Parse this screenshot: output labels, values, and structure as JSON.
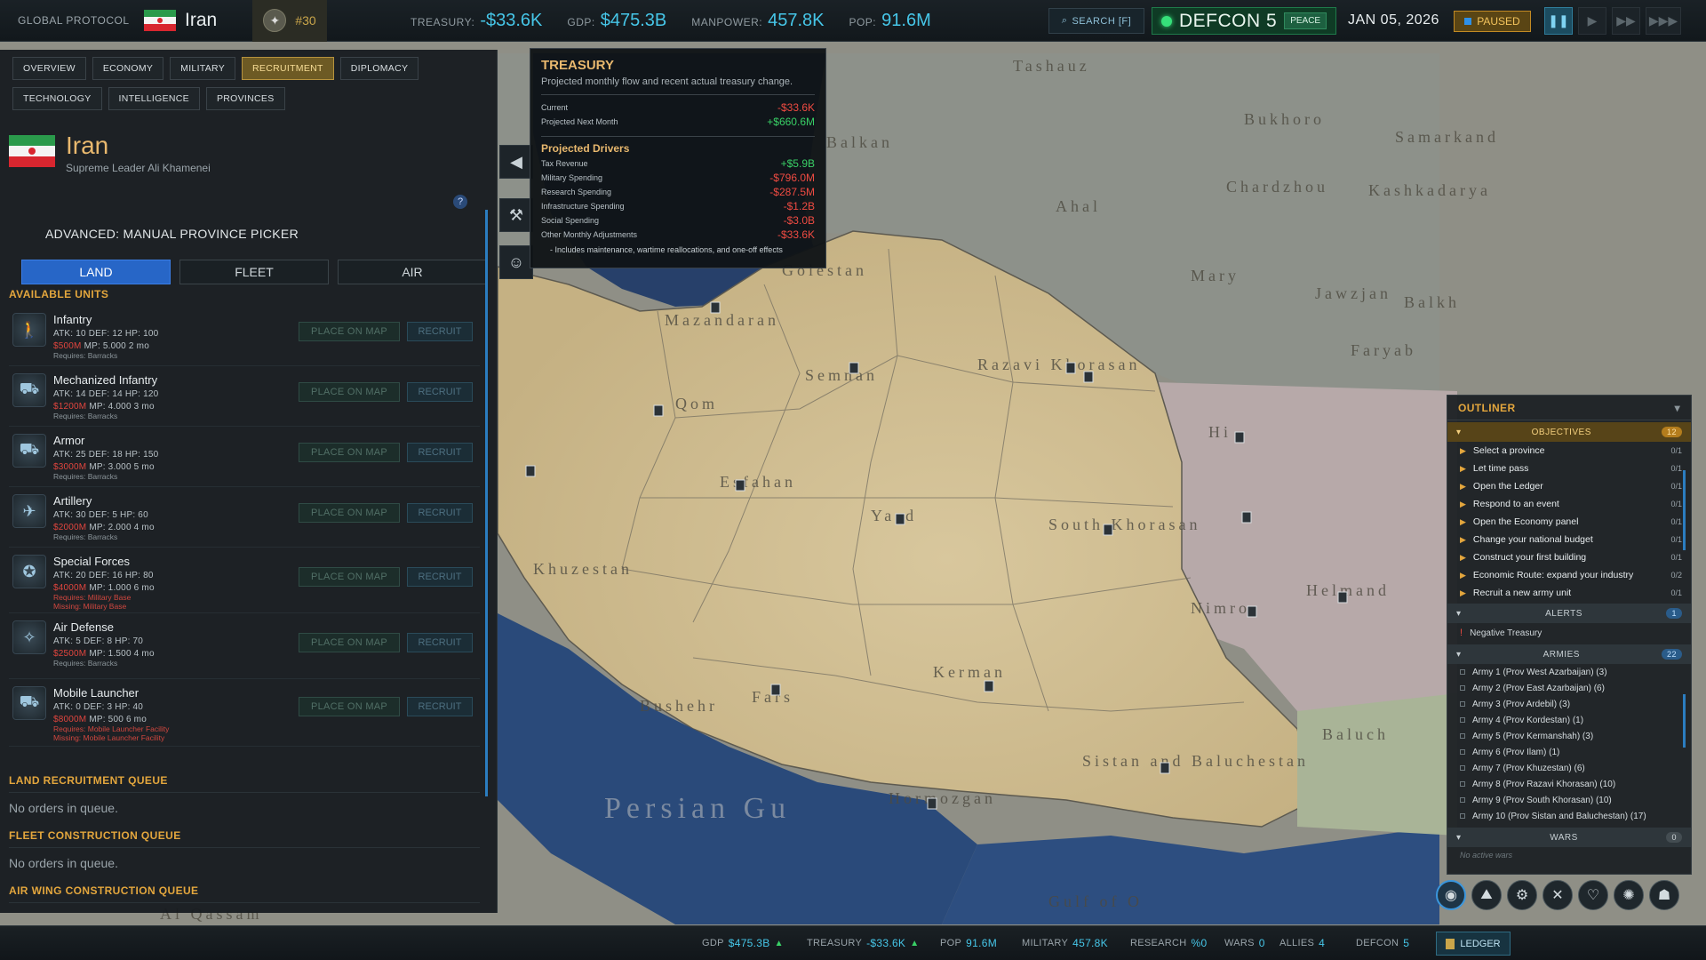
{
  "topbar": {
    "brand": "GLOBAL PROTOCOL",
    "country": "Iran",
    "rank": "#30",
    "treasury_label": "TREASURY:",
    "treasury_value": "-$33.6K",
    "gdp_label": "GDP:",
    "gdp_value": "$475.3B",
    "manpower_label": "MANPOWER:",
    "manpower_value": "457.8K",
    "pop_label": "POP:",
    "pop_value": "91.6M",
    "search_label": "SEARCH [F]",
    "defcon_label": "DEFCON 5",
    "peace_label": "PEACE",
    "date": "JAN 05, 2026",
    "paused_label": "PAUSED",
    "colors": {
      "accent": "#46c6e8",
      "defcon": "#36e07a",
      "paused": "#f3c35c"
    }
  },
  "panel": {
    "tabs": [
      "OVERVIEW",
      "ECONOMY",
      "MILITARY",
      "RECRUITMENT",
      "DIPLOMACY",
      "TECHNOLOGY",
      "INTELLIGENCE",
      "PROVINCES"
    ],
    "active_tab": "RECRUITMENT",
    "country": "Iran",
    "leader": "Supreme Leader Ali Khamenei",
    "help": "?",
    "advanced_label": "ADVANCED: MANUAL PROVINCE PICKER",
    "modes": [
      "LAND",
      "FLEET",
      "AIR"
    ],
    "active_mode": "LAND",
    "available_units_title": "AVAILABLE UNITS",
    "units": [
      {
        "name": "Infantry",
        "stats": "ATK: 10  DEF: 12  HP: 100",
        "cost": "$500M",
        "mp": "MP: 5.000  2 mo",
        "req": "Requires: Barracks",
        "missing": ""
      },
      {
        "name": "Mechanized Infantry",
        "stats": "ATK: 14  DEF: 14  HP: 120",
        "cost": "$1200M",
        "mp": "MP: 4.000  3 mo",
        "req": "Requires: Barracks",
        "missing": ""
      },
      {
        "name": "Armor",
        "stats": "ATK: 25  DEF: 18  HP: 150",
        "cost": "$3000M",
        "mp": "MP: 3.000  5 mo",
        "req": "Requires: Barracks",
        "missing": ""
      },
      {
        "name": "Artillery",
        "stats": "ATK: 30  DEF: 5  HP: 60",
        "cost": "$2000M",
        "mp": "MP: 2.000  4 mo",
        "req": "Requires: Barracks",
        "missing": ""
      },
      {
        "name": "Special Forces",
        "stats": "ATK: 20  DEF: 16  HP: 80",
        "cost": "$4000M",
        "mp": "MP: 1.000  6 mo",
        "req": "Requires: Military Base",
        "missing": "Missing: Military Base"
      },
      {
        "name": "Air Defense",
        "stats": "ATK: 5  DEF: 8  HP: 70",
        "cost": "$2500M",
        "mp": "MP: 1.500  4 mo",
        "req": "Requires: Barracks",
        "missing": ""
      },
      {
        "name": "Mobile Launcher",
        "stats": "ATK: 0  DEF: 3  HP: 40",
        "cost": "$8000M",
        "mp": "MP: 500  6 mo",
        "req": "Requires: Mobile Launcher Facility",
        "missing": "Missing: Mobile Launcher Facility"
      }
    ],
    "place_label": "PLACE ON MAP",
    "recruit_label": "RECRUIT",
    "land_queue_title": "LAND RECRUITMENT QUEUE",
    "fleet_queue_title": "FLEET CONSTRUCTION QUEUE",
    "air_queue_title": "AIR WING CONSTRUCTION QUEUE",
    "empty_queue": "No orders in queue."
  },
  "tooltip": {
    "title": "TREASURY",
    "subtitle": "Projected monthly flow and recent actual treasury change.",
    "current_label": "Current",
    "current_value": "-$33.6K",
    "next_label": "Projected Next Month",
    "next_value": "+$660.6M",
    "drivers_title": "Projected Drivers",
    "drivers": [
      {
        "label": "Tax Revenue",
        "value": "+$5.9B"
      },
      {
        "label": "Military Spending",
        "value": "-$796.0M"
      },
      {
        "label": "Research Spending",
        "value": "-$287.5M"
      },
      {
        "label": "Infrastructure Spending",
        "value": "-$1.2B"
      },
      {
        "label": "Social Spending",
        "value": "-$3.0B"
      },
      {
        "label": "Other Monthly Adjustments",
        "value": "-$33.6K"
      }
    ],
    "note": "- Includes maintenance, wartime reallocations, and one-off effects"
  },
  "map": {
    "labels": [
      "Tashauz",
      "Bukhoro",
      "Samarkand",
      "Balkan",
      "Ahal",
      "Chardzhou",
      "Kashkadarya",
      "Golestan",
      "Mary",
      "Mazandaran",
      "Semnan",
      "Razavi Khorasan",
      "Hi",
      "Qom",
      "Esfahan",
      "Yazd",
      "South Khorasan",
      "Khuzestan",
      "Kerman",
      "Fars",
      "Bushehr",
      "Sistan and Baluchestan",
      "Baluch",
      "Persian Gu",
      "Hormozgan",
      "Helmand",
      "Nimroz",
      "Jawzjan",
      "Balkh",
      "Faryab",
      "Gulf of O",
      "Al Qassam"
    ]
  },
  "outliner": {
    "title": "OUTLINER",
    "objectives_label": "OBJECTIVES",
    "objectives_count": "12",
    "objectives": [
      {
        "label": "Select a province",
        "progress": "0/1"
      },
      {
        "label": "Let time pass",
        "progress": "0/1"
      },
      {
        "label": "Open the Ledger",
        "progress": "0/1"
      },
      {
        "label": "Respond to an event",
        "progress": "0/1"
      },
      {
        "label": "Open the Economy panel",
        "progress": "0/1"
      },
      {
        "label": "Change your national budget",
        "progress": "0/1"
      },
      {
        "label": "Construct your first building",
        "progress": "0/1"
      },
      {
        "label": "Economic Route: expand your industry",
        "progress": "0/2"
      },
      {
        "label": "Recruit a new army unit",
        "progress": "0/1"
      }
    ],
    "alerts_label": "ALERTS",
    "alerts_count": "1",
    "alerts": [
      "Negative Treasury"
    ],
    "armies_label": "ARMIES",
    "armies_count": "22",
    "armies": [
      "Army 1 (Prov West Azarbaijan) (3)",
      "Army 2 (Prov East Azarbaijan) (6)",
      "Army 3 (Prov Ardebil) (3)",
      "Army 4 (Prov Kordestan) (1)",
      "Army 5 (Prov Kermanshah) (3)",
      "Army 6 (Prov Ilam) (1)",
      "Army 7 (Prov Khuzestan) (6)",
      "Army 8 (Prov Razavi Khorasan) (10)",
      "Army 9 (Prov South Khorasan) (10)",
      "Army 10 (Prov Sistan and Baluchestan) (17)"
    ],
    "wars_label": "WARS",
    "wars_count": "0",
    "wars_empty": "No active wars"
  },
  "bottom_icons": [
    "globe-icon",
    "mountain-icon",
    "factory-icon",
    "swords-icon",
    "handshake-icon",
    "atom-icon",
    "spy-icon"
  ],
  "bottombar": {
    "gdp_label": "GDP",
    "gdp_value": "$475.3B",
    "treasury_label": "TREASURY",
    "treasury_value": "-$33.6K",
    "pop_label": "POP",
    "pop_value": "91.6M",
    "military_label": "MILITARY",
    "military_value": "457.8K",
    "research_label": "RESEARCH",
    "research_value": "%0",
    "wars_label": "WARS",
    "wars_value": "0",
    "allies_label": "ALLIES",
    "allies_value": "4",
    "defcon_label": "DEFCON",
    "defcon_value": "5",
    "ledger_label": "LEDGER"
  }
}
